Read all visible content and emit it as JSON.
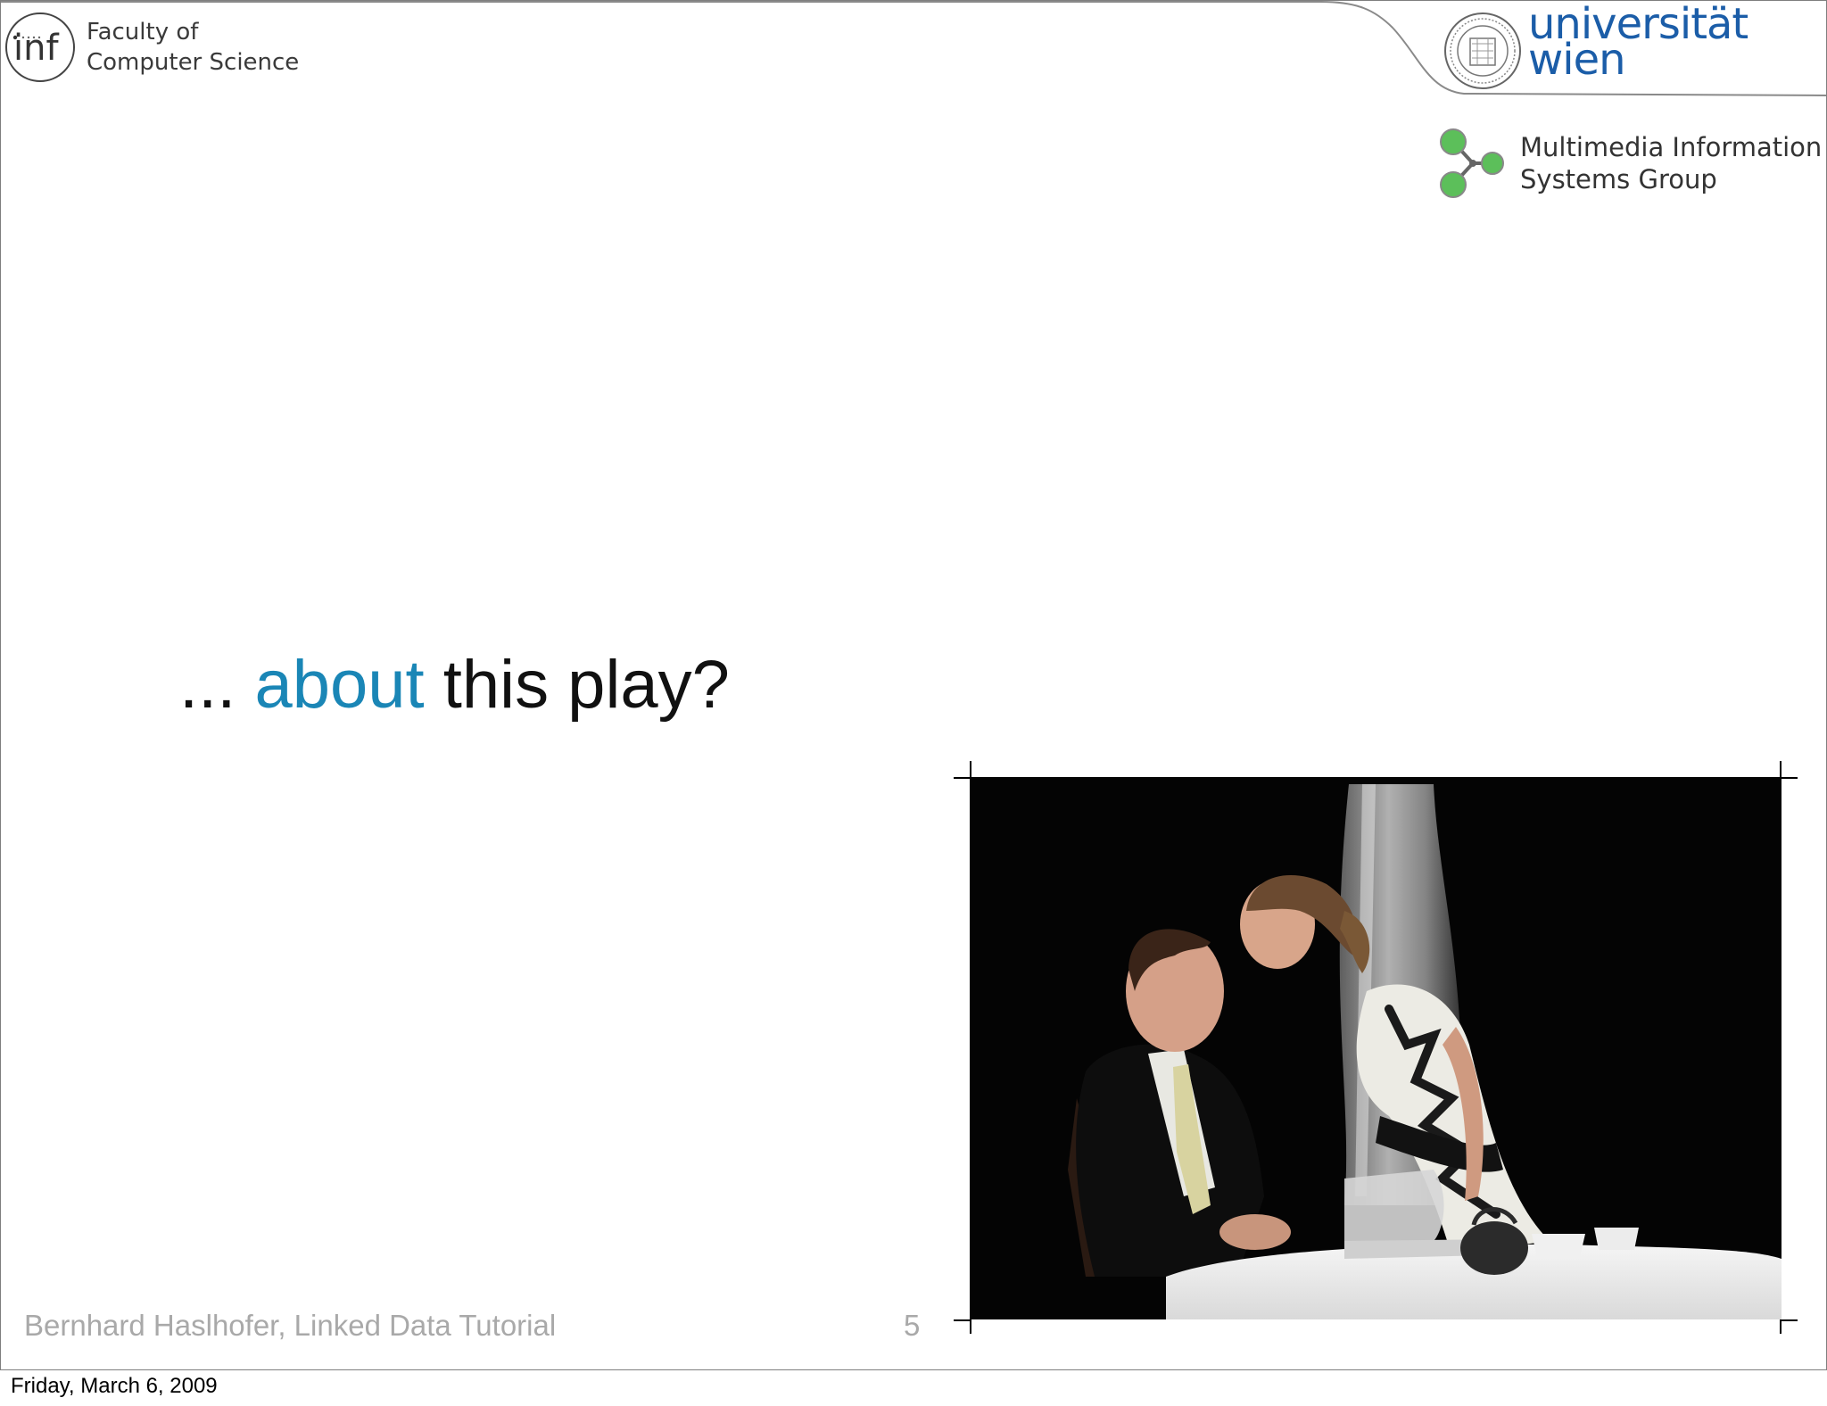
{
  "header": {
    "faculty_logo_glyph": "inf",
    "faculty_line1": "Faculty of",
    "faculty_line2": "Computer Science",
    "university_line1": "universität",
    "university_line2": "wien",
    "group_line1": "Multimedia Information",
    "group_line2": "Systems Group"
  },
  "slide": {
    "title_prefix": "...",
    "title_highlight": "about",
    "title_suffix": "this play?"
  },
  "footer": {
    "author": "Bernhard Haslhofer, Linked Data Tutorial",
    "page_number": "5"
  },
  "print": {
    "date": "Friday, March 6, 2009"
  },
  "colors": {
    "highlight": "#1a86b6",
    "university_blue": "#1b5da8",
    "group_green": "#5cbf5a"
  }
}
